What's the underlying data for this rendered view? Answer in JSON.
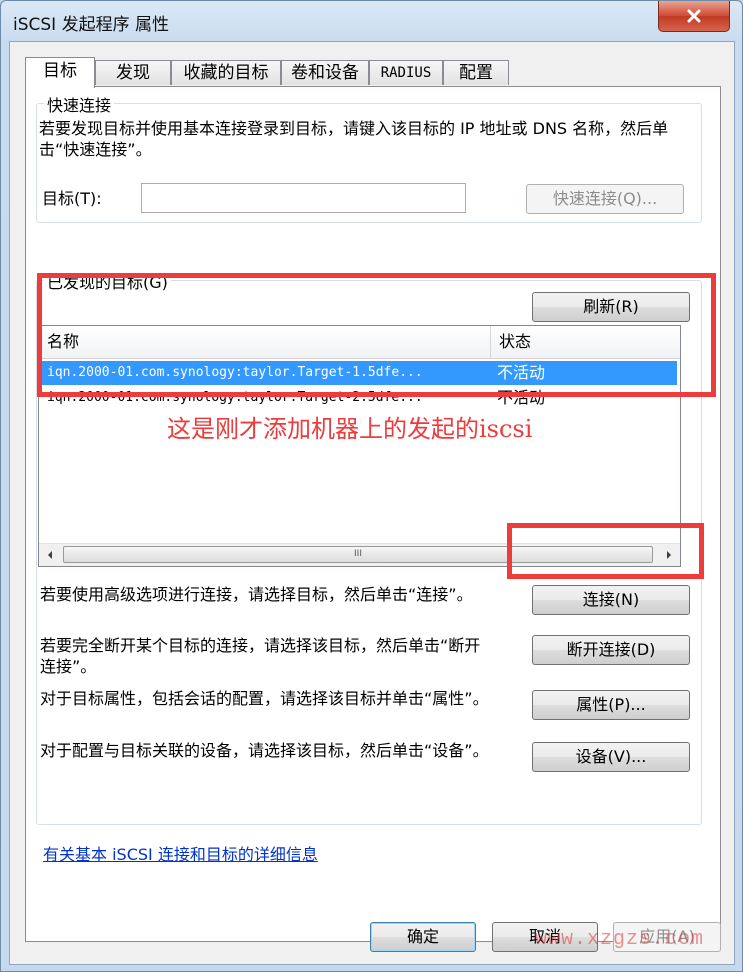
{
  "window": {
    "title": "iSCSI 发起程序 属性"
  },
  "tabs": [
    {
      "label": "目标"
    },
    {
      "label": "发现"
    },
    {
      "label": "收藏的目标"
    },
    {
      "label": "卷和设备"
    },
    {
      "label": "RADIUS"
    },
    {
      "label": "配置"
    }
  ],
  "quick_connect": {
    "group_title": "快速连接",
    "description": "若要发现目标并使用基本连接登录到目标，请键入该目标的 IP 地址或 DNS 名称，然后单击“快速连接”。",
    "target_label": "目标(T):",
    "target_value": "",
    "button_label": "快速连接(Q)..."
  },
  "discovered": {
    "group_title": "已发现的目标(G)",
    "refresh_label": "刷新(R)",
    "columns": [
      "名称",
      "状态"
    ],
    "rows": [
      {
        "name": "iqn.2000-01.com.synology:taylor.Target-1.5dfe...",
        "state": "不活动"
      },
      {
        "name": "iqn.2000-01.com.synology:taylor.Target-2.5dfe...",
        "state": "不活动"
      }
    ],
    "scroll_thumb_glyph": "III"
  },
  "actions": [
    {
      "description": "若要使用高级选项进行连接，请选择目标，然后单击“连接”。",
      "button": "连接(N)"
    },
    {
      "description": "若要完全断开某个目标的连接，请选择该目标，然后单击“断开连接”。",
      "button": "断开连接(D)"
    },
    {
      "description": "对于目标属性，包括会话的配置，请选择该目标并单击“属性”。",
      "button": "属性(P)..."
    },
    {
      "description": "对于配置与目标关联的设备，请选择该目标，然后单击“设备”。",
      "button": "设备(V)..."
    }
  ],
  "info_link": "有关基本 iSCSI 连接和目标的详细信息",
  "footer": {
    "ok": "确定",
    "cancel": "取消",
    "apply": "应用(A)"
  },
  "annotation": {
    "text": "这是刚才添加机器上的发起的iscsi",
    "color": "#ee3b3b"
  },
  "watermark": "www.xzgzs.com",
  "colors": {
    "selection": "#3399ff",
    "annotation": "#ee3b3b",
    "link": "#0033cc"
  }
}
